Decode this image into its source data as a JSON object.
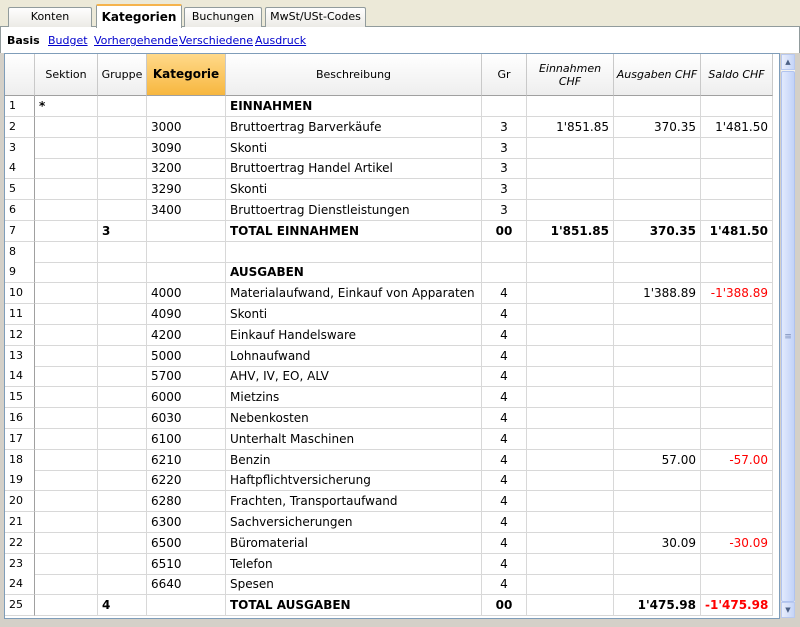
{
  "tabs": [
    {
      "label": "Konten",
      "active": false
    },
    {
      "label": "Kategorien",
      "active": true
    },
    {
      "label": "Buchungen",
      "active": false
    },
    {
      "label": "MwSt/USt-Codes",
      "active": false
    }
  ],
  "views": [
    {
      "label": "Basis",
      "active": true
    },
    {
      "label": "Budget",
      "active": false
    },
    {
      "label": "Vorhergehende",
      "active": false
    },
    {
      "label": "Verschiedene",
      "active": false
    },
    {
      "label": "Ausdruck",
      "active": false
    }
  ],
  "columns": {
    "rownum": "",
    "sektion": "Sektion",
    "gruppe": "Gruppe",
    "kategorie": "Kategorie",
    "beschreibung": "Beschreibung",
    "gr": "Gr",
    "einnahmen": "Einnahmen CHF",
    "ausgaben": "Ausgaben CHF",
    "saldo": "Saldo CHF"
  },
  "rows": [
    {
      "n": "1",
      "sektion": "*",
      "gruppe": "",
      "kategorie": "",
      "beschreibung": "EINNAHMEN",
      "gr": "",
      "einnahmen": "",
      "ausgaben": "",
      "saldo": "",
      "bold": true
    },
    {
      "n": "2",
      "sektion": "",
      "gruppe": "",
      "kategorie": "3000",
      "beschreibung": "Bruttoertrag Barverkäufe",
      "gr": "3",
      "einnahmen": "1'851.85",
      "ausgaben": "370.35",
      "saldo": "1'481.50"
    },
    {
      "n": "3",
      "sektion": "",
      "gruppe": "",
      "kategorie": "3090",
      "beschreibung": "Skonti",
      "gr": "3",
      "einnahmen": "",
      "ausgaben": "",
      "saldo": ""
    },
    {
      "n": "4",
      "sektion": "",
      "gruppe": "",
      "kategorie": "3200",
      "beschreibung": "Bruttoertrag Handel Artikel",
      "gr": "3",
      "einnahmen": "",
      "ausgaben": "",
      "saldo": ""
    },
    {
      "n": "5",
      "sektion": "",
      "gruppe": "",
      "kategorie": "3290",
      "beschreibung": "Skonti",
      "gr": "3",
      "einnahmen": "",
      "ausgaben": "",
      "saldo": ""
    },
    {
      "n": "6",
      "sektion": "",
      "gruppe": "",
      "kategorie": "3400",
      "beschreibung": "Bruttoertrag Dienstleistungen",
      "gr": "3",
      "einnahmen": "",
      "ausgaben": "",
      "saldo": ""
    },
    {
      "n": "7",
      "sektion": "",
      "gruppe": "3",
      "kategorie": "",
      "beschreibung": "TOTAL EINNAHMEN",
      "gr": "00",
      "einnahmen": "1'851.85",
      "ausgaben": "370.35",
      "saldo": "1'481.50",
      "bold": true
    },
    {
      "n": "8",
      "sektion": "",
      "gruppe": "",
      "kategorie": "",
      "beschreibung": "",
      "gr": "",
      "einnahmen": "",
      "ausgaben": "",
      "saldo": ""
    },
    {
      "n": "9",
      "sektion": "",
      "gruppe": "",
      "kategorie": "",
      "beschreibung": "AUSGABEN",
      "gr": "",
      "einnahmen": "",
      "ausgaben": "",
      "saldo": "",
      "bold": true
    },
    {
      "n": "10",
      "sektion": "",
      "gruppe": "",
      "kategorie": "4000",
      "beschreibung": "Materialaufwand, Einkauf von Apparaten",
      "gr": "4",
      "einnahmen": "",
      "ausgaben": "1'388.89",
      "saldo": "-1'388.89",
      "neg": true
    },
    {
      "n": "11",
      "sektion": "",
      "gruppe": "",
      "kategorie": "4090",
      "beschreibung": "Skonti",
      "gr": "4",
      "einnahmen": "",
      "ausgaben": "",
      "saldo": ""
    },
    {
      "n": "12",
      "sektion": "",
      "gruppe": "",
      "kategorie": "4200",
      "beschreibung": "Einkauf Handelsware",
      "gr": "4",
      "einnahmen": "",
      "ausgaben": "",
      "saldo": ""
    },
    {
      "n": "13",
      "sektion": "",
      "gruppe": "",
      "kategorie": "5000",
      "beschreibung": "Lohnaufwand",
      "gr": "4",
      "einnahmen": "",
      "ausgaben": "",
      "saldo": ""
    },
    {
      "n": "14",
      "sektion": "",
      "gruppe": "",
      "kategorie": "5700",
      "beschreibung": "AHV, IV, EO, ALV",
      "gr": "4",
      "einnahmen": "",
      "ausgaben": "",
      "saldo": ""
    },
    {
      "n": "15",
      "sektion": "",
      "gruppe": "",
      "kategorie": "6000",
      "beschreibung": "Mietzins",
      "gr": "4",
      "einnahmen": "",
      "ausgaben": "",
      "saldo": ""
    },
    {
      "n": "16",
      "sektion": "",
      "gruppe": "",
      "kategorie": "6030",
      "beschreibung": "Nebenkosten",
      "gr": "4",
      "einnahmen": "",
      "ausgaben": "",
      "saldo": ""
    },
    {
      "n": "17",
      "sektion": "",
      "gruppe": "",
      "kategorie": "6100",
      "beschreibung": "Unterhalt Maschinen",
      "gr": "4",
      "einnahmen": "",
      "ausgaben": "",
      "saldo": ""
    },
    {
      "n": "18",
      "sektion": "",
      "gruppe": "",
      "kategorie": "6210",
      "beschreibung": "Benzin",
      "gr": "4",
      "einnahmen": "",
      "ausgaben": "57.00",
      "saldo": "-57.00",
      "neg": true
    },
    {
      "n": "19",
      "sektion": "",
      "gruppe": "",
      "kategorie": "6220",
      "beschreibung": "Haftpflichtversicherung",
      "gr": "4",
      "einnahmen": "",
      "ausgaben": "",
      "saldo": ""
    },
    {
      "n": "20",
      "sektion": "",
      "gruppe": "",
      "kategorie": "6280",
      "beschreibung": "Frachten, Transportaufwand",
      "gr": "4",
      "einnahmen": "",
      "ausgaben": "",
      "saldo": ""
    },
    {
      "n": "21",
      "sektion": "",
      "gruppe": "",
      "kategorie": "6300",
      "beschreibung": "Sachversicherungen",
      "gr": "4",
      "einnahmen": "",
      "ausgaben": "",
      "saldo": ""
    },
    {
      "n": "22",
      "sektion": "",
      "gruppe": "",
      "kategorie": "6500",
      "beschreibung": "Büromaterial",
      "gr": "4",
      "einnahmen": "",
      "ausgaben": "30.09",
      "saldo": "-30.09",
      "neg": true
    },
    {
      "n": "23",
      "sektion": "",
      "gruppe": "",
      "kategorie": "6510",
      "beschreibung": "Telefon",
      "gr": "4",
      "einnahmen": "",
      "ausgaben": "",
      "saldo": ""
    },
    {
      "n": "24",
      "sektion": "",
      "gruppe": "",
      "kategorie": "6640",
      "beschreibung": "Spesen",
      "gr": "4",
      "einnahmen": "",
      "ausgaben": "",
      "saldo": ""
    },
    {
      "n": "25",
      "sektion": "",
      "gruppe": "4",
      "kategorie": "",
      "beschreibung": "TOTAL AUSGABEN",
      "gr": "00",
      "einnahmen": "",
      "ausgaben": "1'475.98",
      "saldo": "-1'475.98",
      "bold": true,
      "neg": true
    }
  ],
  "scrollbar": {
    "up_icon": "scroll-up-icon",
    "down_icon": "scroll-down-icon",
    "grip_icon": "grip-icon"
  },
  "colors": {
    "accent": "#f7b73f",
    "link": "#0000cc",
    "negative": "#ff0000"
  }
}
